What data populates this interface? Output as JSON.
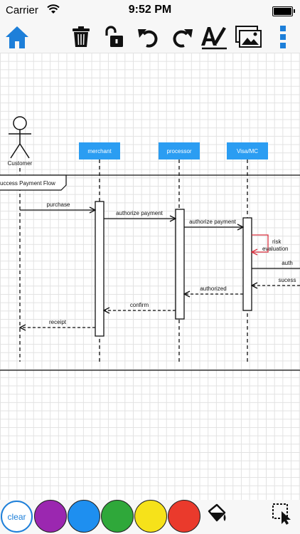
{
  "status_bar": {
    "carrier": "Carrier",
    "time": "9:52 PM",
    "wifi_icon": "wifi-icon",
    "battery_icon": "battery-icon"
  },
  "toolbar": {
    "items": [
      "home-icon",
      "trash-icon",
      "unlock-icon",
      "undo-icon",
      "redo-icon",
      "text-pen-icon",
      "image-icon",
      "more-icon"
    ],
    "accent": "#1d7fd9"
  },
  "diagram": {
    "actor": "Customer",
    "participants": [
      "merchant",
      "processor",
      "Visa/MC"
    ],
    "frame_label": "success Payment Flow",
    "messages": [
      {
        "label": "purchase"
      },
      {
        "label": "authorize payment"
      },
      {
        "label": "authorize payment"
      },
      {
        "label": "risk\nevaluation"
      },
      {
        "label": "auth"
      },
      {
        "label": "sucess"
      },
      {
        "label": "authorized"
      },
      {
        "label": "confirm"
      },
      {
        "label": "receipt"
      }
    ],
    "participant_color": "#2b9df2",
    "self_call_color": "#d9303f"
  },
  "palette": {
    "clear_label": "clear",
    "colors": [
      "#9b27b0",
      "#1e8ff0",
      "#2fa83a",
      "#f6e21a",
      "#ea3a2c"
    ],
    "tools": [
      "paint-bucket-icon",
      "select-cursor-icon"
    ]
  }
}
